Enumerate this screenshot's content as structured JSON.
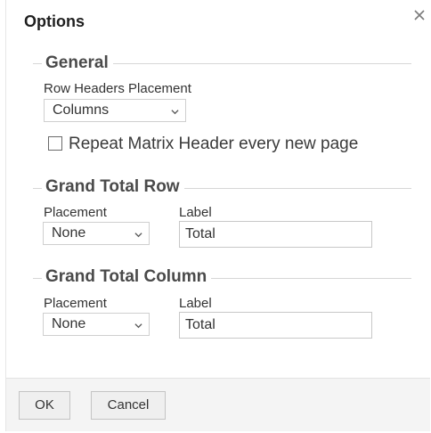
{
  "dialog": {
    "title": "Options",
    "close_icon": "close-icon"
  },
  "general": {
    "title": "General",
    "row_headers_placement_label": "Row Headers Placement",
    "row_headers_placement_value": "Columns",
    "repeat_header_label": "Repeat Matrix Header every new page",
    "repeat_header_checked": false
  },
  "grand_total_row": {
    "title": "Grand Total Row",
    "placement_label": "Placement",
    "placement_value": "None",
    "label_label": "Label",
    "label_value": "Total"
  },
  "grand_total_column": {
    "title": "Grand Total Column",
    "placement_label": "Placement",
    "placement_value": "None",
    "label_label": "Label",
    "label_value": "Total"
  },
  "footer": {
    "ok_label": "OK",
    "cancel_label": "Cancel"
  }
}
